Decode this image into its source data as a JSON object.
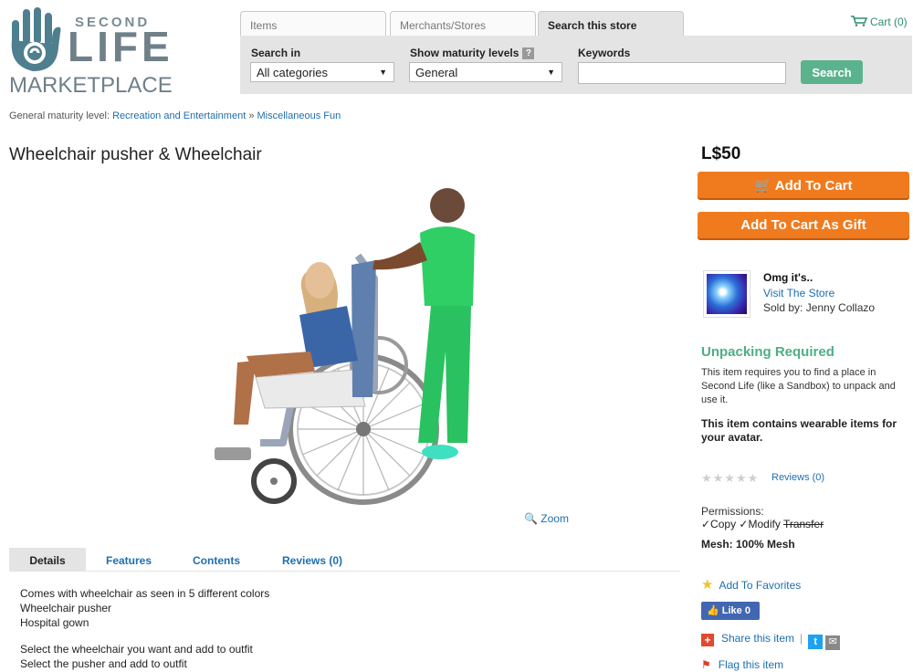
{
  "logo": {
    "second": "SECOND",
    "life": "LIFE",
    "marketplace": "MARKETPLACE"
  },
  "tabs": [
    {
      "label": "Items"
    },
    {
      "label": "Merchants/Stores"
    },
    {
      "label": "Search this store"
    }
  ],
  "search": {
    "search_in_label": "Search in",
    "search_in_value": "All categories",
    "maturity_label": "Show maturity levels",
    "maturity_value": "General",
    "keywords_label": "Keywords",
    "keywords_value": "",
    "button": "Search"
  },
  "cart": {
    "label": "Cart (0)"
  },
  "breadcrumb": {
    "prefix": "General maturity level:",
    "category": "Recreation and Entertainment",
    "separator": "»",
    "subcategory": "Miscellaneous Fun"
  },
  "product": {
    "title": "Wheelchair pusher & Wheelchair",
    "zoom": "Zoom"
  },
  "detail_tabs": [
    {
      "label": "Details"
    },
    {
      "label": "Features"
    },
    {
      "label": "Contents"
    },
    {
      "label": "Reviews (0)"
    }
  ],
  "details": [
    "Comes with wheelchair as seen in 5 different colors",
    "Wheelchair pusher",
    "Hospital gown",
    "Select the wheelchair you want and add to outfit",
    "Select the pusher and add to outfit"
  ],
  "sidebar": {
    "price": "L$50",
    "add_to_cart": "Add To Cart",
    "add_to_cart_gift": "Add To Cart As Gift",
    "store_name": "Omg it's..",
    "visit_store": "Visit The Store",
    "sold_by": "Sold by: Jenny Collazo",
    "unpacking_title": "Unpacking Required",
    "unpacking_text": "This item requires you to find a place in Second Life (like a Sandbox) to unpack and use it.",
    "wearable_text": "This item contains wearable items for your avatar.",
    "rating": 0,
    "reviews_link": "Reviews (0)",
    "permissions_label": "Permissions:",
    "perm_copy": "✓Copy",
    "perm_modify": "✓Modify",
    "perm_transfer": "Transfer",
    "mesh": "Mesh: 100% Mesh",
    "add_favorites": "Add To Favorites",
    "like": "Like 0",
    "share": "Share this item",
    "share_separator": "|",
    "flag": "Flag this item"
  },
  "colors": {
    "accent_green": "#5bb38e",
    "orange_button": "#f07b1f",
    "link_blue": "#1e6fae"
  }
}
